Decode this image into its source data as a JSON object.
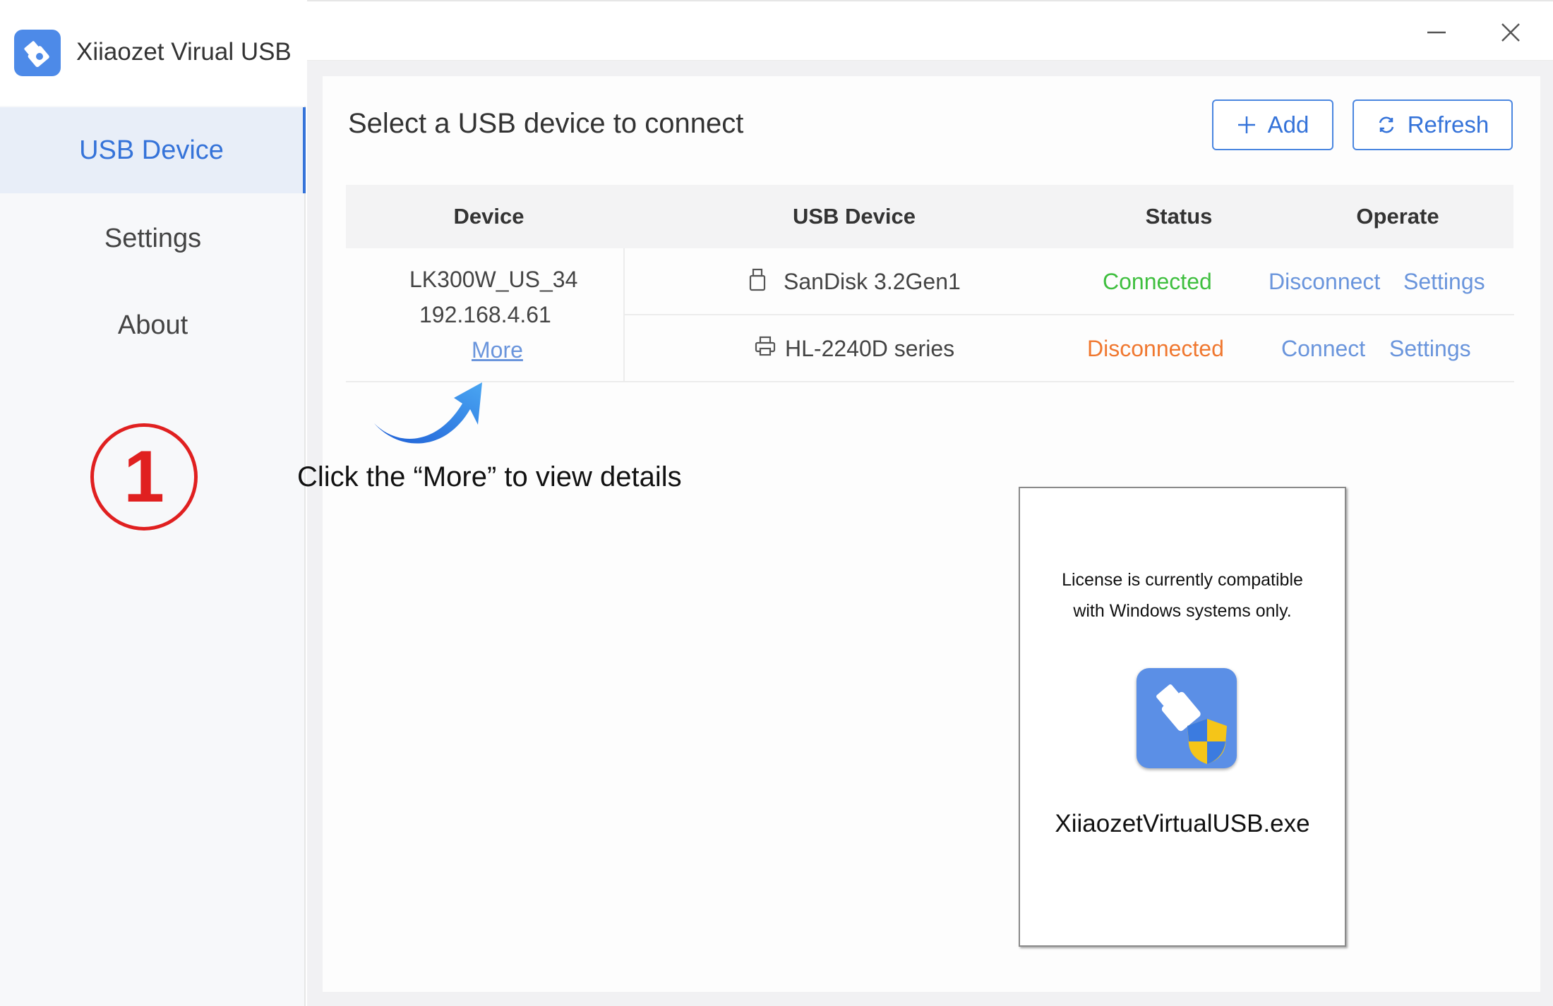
{
  "app": {
    "title": "Xiiaozet Virual USB"
  },
  "sidebar": {
    "items": [
      {
        "label": "USB Device",
        "active": true
      },
      {
        "label": "Settings",
        "active": false
      },
      {
        "label": "About",
        "active": false
      }
    ],
    "step_number": "1"
  },
  "window": {
    "minimize_icon": "minimize-icon",
    "close_icon": "close-icon"
  },
  "main": {
    "title": "Select a USB device to connect",
    "add_button": {
      "icon": "plus-icon",
      "label": "Add"
    },
    "refresh_button": {
      "icon": "refresh-icon",
      "label": "Refresh"
    },
    "table": {
      "headers": [
        "Device",
        "USB Device",
        "Status",
        "Operate"
      ],
      "device": {
        "name": "LK300W_US_34",
        "ip": "192.168.4.61",
        "more_label": "More"
      },
      "rows": [
        {
          "icon": "usb-drive-icon",
          "usb_device": "SanDisk 3.2Gen1",
          "status": "Connected",
          "action": "Disconnect",
          "settings": "Settings"
        },
        {
          "icon": "printer-icon",
          "usb_device": "HL-2240D series",
          "status": "Disconnected",
          "action": "Connect",
          "settings": "Settings"
        }
      ]
    },
    "hint": "Click the “More” to view details"
  },
  "card": {
    "line1": "License is currently compatible",
    "line2": "with Windows systems only.",
    "exe_name": "XiiaozetVirtualUSB.exe"
  },
  "colors": {
    "accent": "#3573d9",
    "connected": "#3fbf3f",
    "disconnected": "#f07830",
    "step_red": "#e02020"
  }
}
